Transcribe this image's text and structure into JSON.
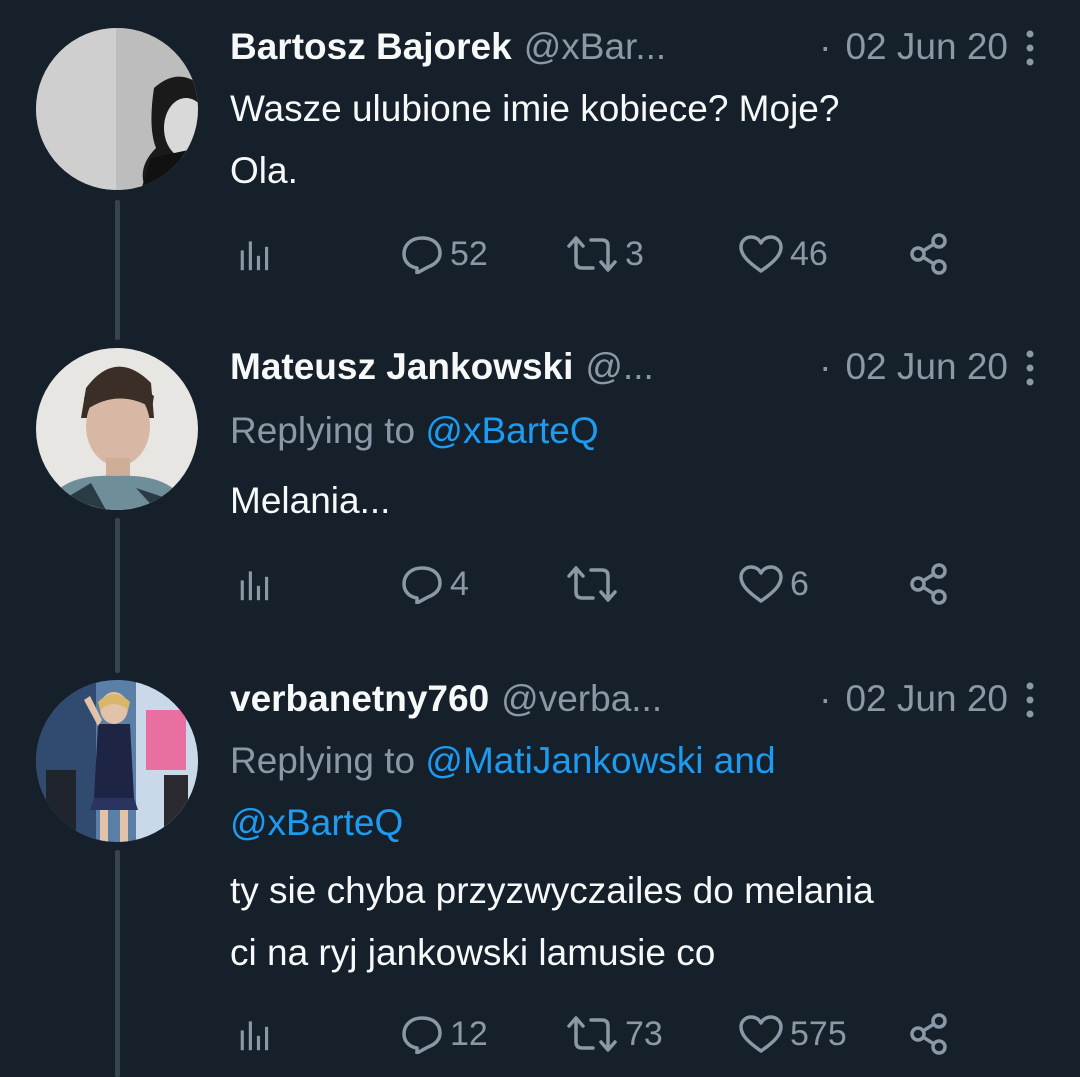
{
  "colors": {
    "background": "#15202b",
    "text_primary": "#f7f9f9",
    "text_secondary": "#8b98a5",
    "link": "#1d9bf0",
    "thread_line": "#38444d"
  },
  "icons": [
    "analytics-icon",
    "reply-icon",
    "retweet-icon",
    "like-icon",
    "share-icon",
    "more-icon"
  ],
  "tweets": [
    {
      "name": "Bartosz Bajorek",
      "handle": "@xBar...",
      "separator": "·",
      "date": "02 Jun 20",
      "replying_prefix": "",
      "replying_to": "",
      "text_lines": [
        "Wasze ulubione imie kobiece? Moje?",
        "Ola."
      ],
      "replies": "52",
      "retweets": "3",
      "likes": "46"
    },
    {
      "name": "Mateusz Jankowski",
      "handle": "@...",
      "separator": "·",
      "date": "02 Jun 20",
      "replying_prefix": "Replying to",
      "replying_to": "@xBarteQ",
      "text_lines": [
        "Melania..."
      ],
      "replies": "4",
      "retweets": "",
      "likes": "6"
    },
    {
      "name": "verbanetny760",
      "handle": "@verba...",
      "separator": "·",
      "date": "02 Jun 20",
      "replying_prefix": "Replying to",
      "replying_to_line1": "@MatiJankowski and",
      "replying_to_line2": "@xBarteQ",
      "text_lines": [
        "ty sie chyba przyzwyczailes do melania",
        "ci na ryj jankowski lamusie co"
      ],
      "replies": "12",
      "retweets": "73",
      "likes": "575"
    }
  ]
}
